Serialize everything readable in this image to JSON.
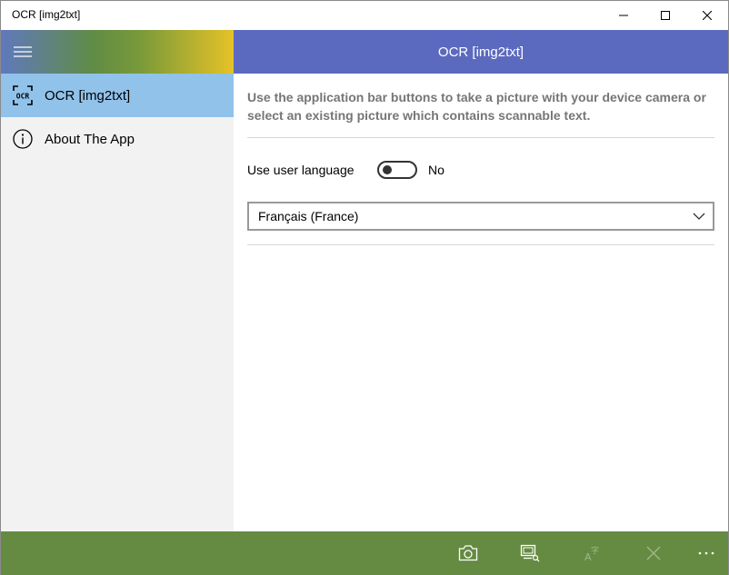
{
  "window": {
    "title": "OCR [img2txt]"
  },
  "pane": {
    "items": [
      {
        "label": "OCR [img2txt]",
        "icon": "ocr-scan-icon",
        "selected": true
      },
      {
        "label": "About The App",
        "icon": "info-icon",
        "selected": false
      }
    ]
  },
  "page": {
    "header_title": "OCR [img2txt]",
    "intro_text": "Use the application bar buttons to take a picture with your device camera or select an existing picture which contains scannable text.",
    "user_language_label": "Use user language",
    "user_language_state": "No",
    "language_selected": "Français (France)"
  },
  "appbar": {
    "buttons": [
      "camera-icon",
      "browse-picture-icon",
      "translate-icon",
      "clear-icon",
      "more-icon"
    ]
  },
  "colors": {
    "content_header": "#5b6abf",
    "selected_nav": "#91c2ea",
    "appbar": "#658b42",
    "pane_bg": "#f2f2f2"
  }
}
